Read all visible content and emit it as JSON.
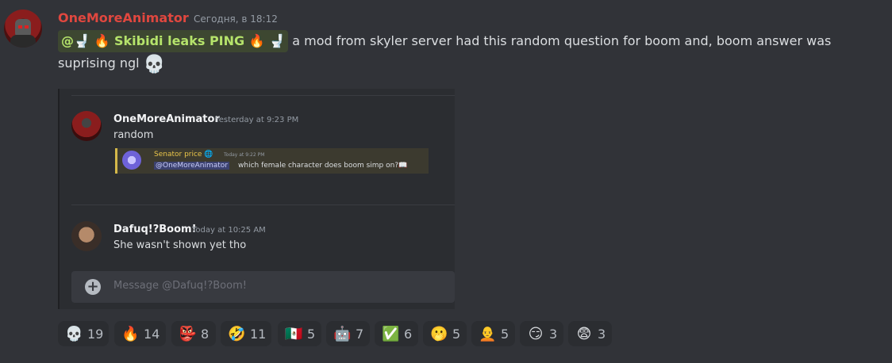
{
  "message": {
    "username": "OneMoreAnimator",
    "timestamp": "Сегодня, в 18:12",
    "mention": "@🚽 🔥 Skibidi leaks PING 🔥 🚽",
    "text": " a mod from skyler server had this random question for boom and, boom answer was suprising ngl ",
    "trailing_emoji": "💀"
  },
  "embed": {
    "msg1": {
      "author": "OneMoreAnimator",
      "time": "Yesterday at 9:23 PM",
      "text": "random"
    },
    "reply": {
      "author": "Senator price 🌐",
      "time": "Today at 9:22 PM",
      "mention": "@OneMoreAnimator",
      "text": "which female character does boom simp on?📖"
    },
    "msg2": {
      "author": "Dafuq!?Boom!",
      "time": "Today at 10:25 AM",
      "text": "She wasn't shown yet tho"
    },
    "input_placeholder": "Message @Dafuq!?Boom!",
    "plus": "+"
  },
  "reactions": [
    {
      "emoji": "💀",
      "count": "19"
    },
    {
      "emoji": "🔥",
      "count": "14"
    },
    {
      "emoji": "👺",
      "count": "8"
    },
    {
      "emoji": "🤣",
      "count": "11"
    },
    {
      "emoji": "🇲🇽",
      "count": "5"
    },
    {
      "emoji": "🤖",
      "count": "7"
    },
    {
      "emoji": "✅",
      "count": "6"
    },
    {
      "emoji": "🫢",
      "count": "5"
    },
    {
      "emoji": "🧑‍🦲",
      "count": "5"
    },
    {
      "emoji": "😏",
      "count": "3"
    },
    {
      "emoji": "😨",
      "count": "3"
    }
  ],
  "colors": {
    "background": "#313338",
    "username": "#e0473f",
    "mention_bg": "#3d4731",
    "mention_text": "#b5e36b"
  }
}
